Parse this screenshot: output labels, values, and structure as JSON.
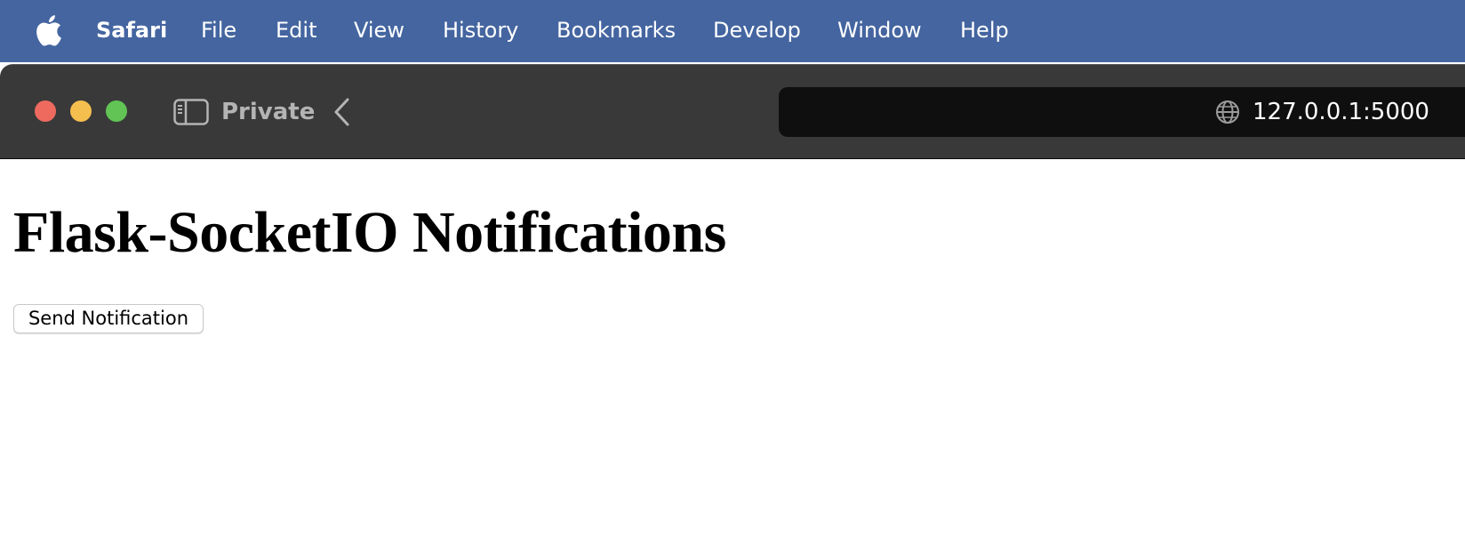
{
  "menubar": {
    "apple_icon": "apple-logo-icon",
    "app_name": "Safari",
    "items": [
      "File",
      "Edit",
      "View",
      "History",
      "Bookmarks",
      "Develop",
      "Window",
      "Help"
    ]
  },
  "window": {
    "traffic_lights": {
      "close_color": "#ee6a5f",
      "minimize_color": "#f5bf4f",
      "maximize_color": "#61c454"
    },
    "toolbar": {
      "sidebar_icon": "sidebar-icon",
      "private_label": "Private",
      "back_icon": "chevron-left-icon",
      "address": {
        "icon": "globe-icon",
        "url": "127.0.0.1:5000"
      }
    }
  },
  "page": {
    "title": "Flask-SocketIO Notifications",
    "send_button_label": "Send Notification"
  },
  "colors": {
    "menubar_bg": "#4465a0",
    "toolbar_bg": "#393939",
    "addressbar_bg": "#0f0f0f"
  }
}
